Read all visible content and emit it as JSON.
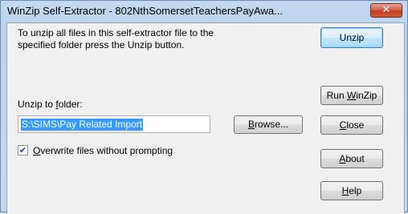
{
  "window": {
    "title": "WinZip Self-Extractor - 802NthSomersetTeachersPayAwa...",
    "close_glyph": "✕"
  },
  "dialog": {
    "intro_line1": "To unzip all files in this self-extractor file to the",
    "intro_line2": "specified folder press the Unzip button.",
    "folder_label_pre": "Unzip to ",
    "folder_label_u": "f",
    "folder_label_post": "older:",
    "folder_value": "S:\\SIMS\\Pay Related Import",
    "browse_u": "B",
    "browse_rest": "rowse...",
    "overwrite_checked": true,
    "overwrite_u": "O",
    "overwrite_rest": "verwrite files without prompting"
  },
  "buttons": {
    "unzip": "Unzip",
    "runwinzip_pre": "Run ",
    "runwinzip_u": "W",
    "runwinzip_post": "inZip",
    "close_u": "C",
    "close_rest": "lose",
    "about_u": "A",
    "about_rest": "bout",
    "help_u": "H",
    "help_rest": "elp"
  }
}
